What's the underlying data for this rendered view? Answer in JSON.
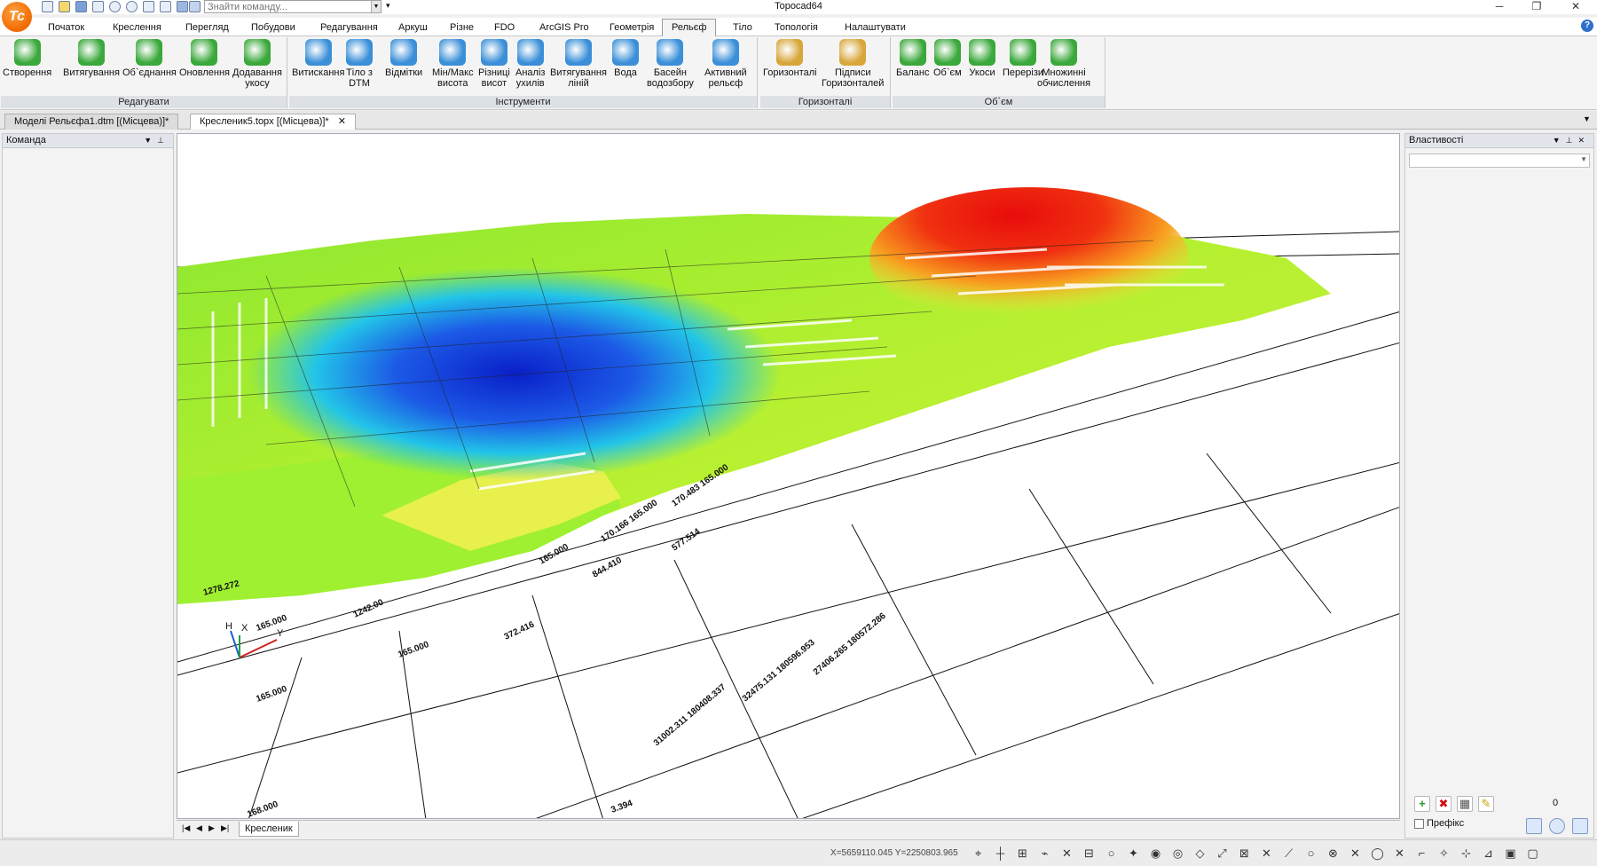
{
  "app": {
    "title": "Topocad64",
    "logo_text": "Tc",
    "find_command_placeholder": "Знайти команду..."
  },
  "menu": {
    "tabs": [
      "Початок",
      "Креслення",
      "Перегляд",
      "Побудови",
      "Редагування",
      "Аркуш",
      "Різне",
      "FDO",
      "ArcGIS Pro",
      "Геометрія",
      "Рельєф",
      "Тіло",
      "Топологія",
      "Налаштувати"
    ],
    "active": "Рельєф"
  },
  "ribbon": {
    "groups": [
      {
        "label": "Редагувати",
        "buttons": [
          "Створення",
          "Витягування",
          "Об`єднання",
          "Оновлення",
          "Додавання\nукосу"
        ]
      },
      {
        "label": "Інструменти",
        "buttons": [
          "Витискання",
          "Тіло з\nDTM",
          "Відмітки",
          "Мін/Макс\nвисота",
          "Різниці\nвисот",
          "Аналіз\nухилів",
          "Витягування\nліній",
          "Вода",
          "Басейн\nводозбору",
          "Активний\nрельєф"
        ]
      },
      {
        "label": "Горизонталі",
        "buttons": [
          "Горизонталі",
          "Підписи\nГоризонталей"
        ]
      },
      {
        "label": "Об`єм",
        "buttons": [
          "Баланс",
          "Об`єм",
          "Укоси",
          "Перерізи",
          "Множинні\nобчислення"
        ]
      }
    ]
  },
  "doc_tabs": [
    {
      "label": "Моделі Рельєфа1.dtm [(Місцева)]*",
      "active": false
    },
    {
      "label": "Кресленик5.topx [(Місцева)]*",
      "active": true
    }
  ],
  "panels": {
    "left_title": "Команда",
    "right_title": "Властивості",
    "prefix_label": "Префікс",
    "count": "0"
  },
  "viewport": {
    "sheet_tab": "Кресленик",
    "axis_labels": {
      "h": "H",
      "x": "X",
      "y": "Y"
    },
    "grid_labels": [
      "1278.272",
      "165.000",
      "1242.00",
      "165.000",
      "372.416",
      "165.000",
      "165.000",
      "844.410",
      "170.166 165.000",
      "577.514",
      "170.483 165.000",
      "31002.311 180408.337",
      "32475.131 180596.953",
      "27406.265 180572.286",
      "3.394",
      "168.000"
    ]
  },
  "status": {
    "coordinates": "X=5659110.045 Y=2250803.965"
  },
  "colors": {
    "terrain_low": "#1030d0",
    "terrain_mid": "#40e040",
    "terrain_high": "#e81010",
    "accent": "#f06a00"
  }
}
